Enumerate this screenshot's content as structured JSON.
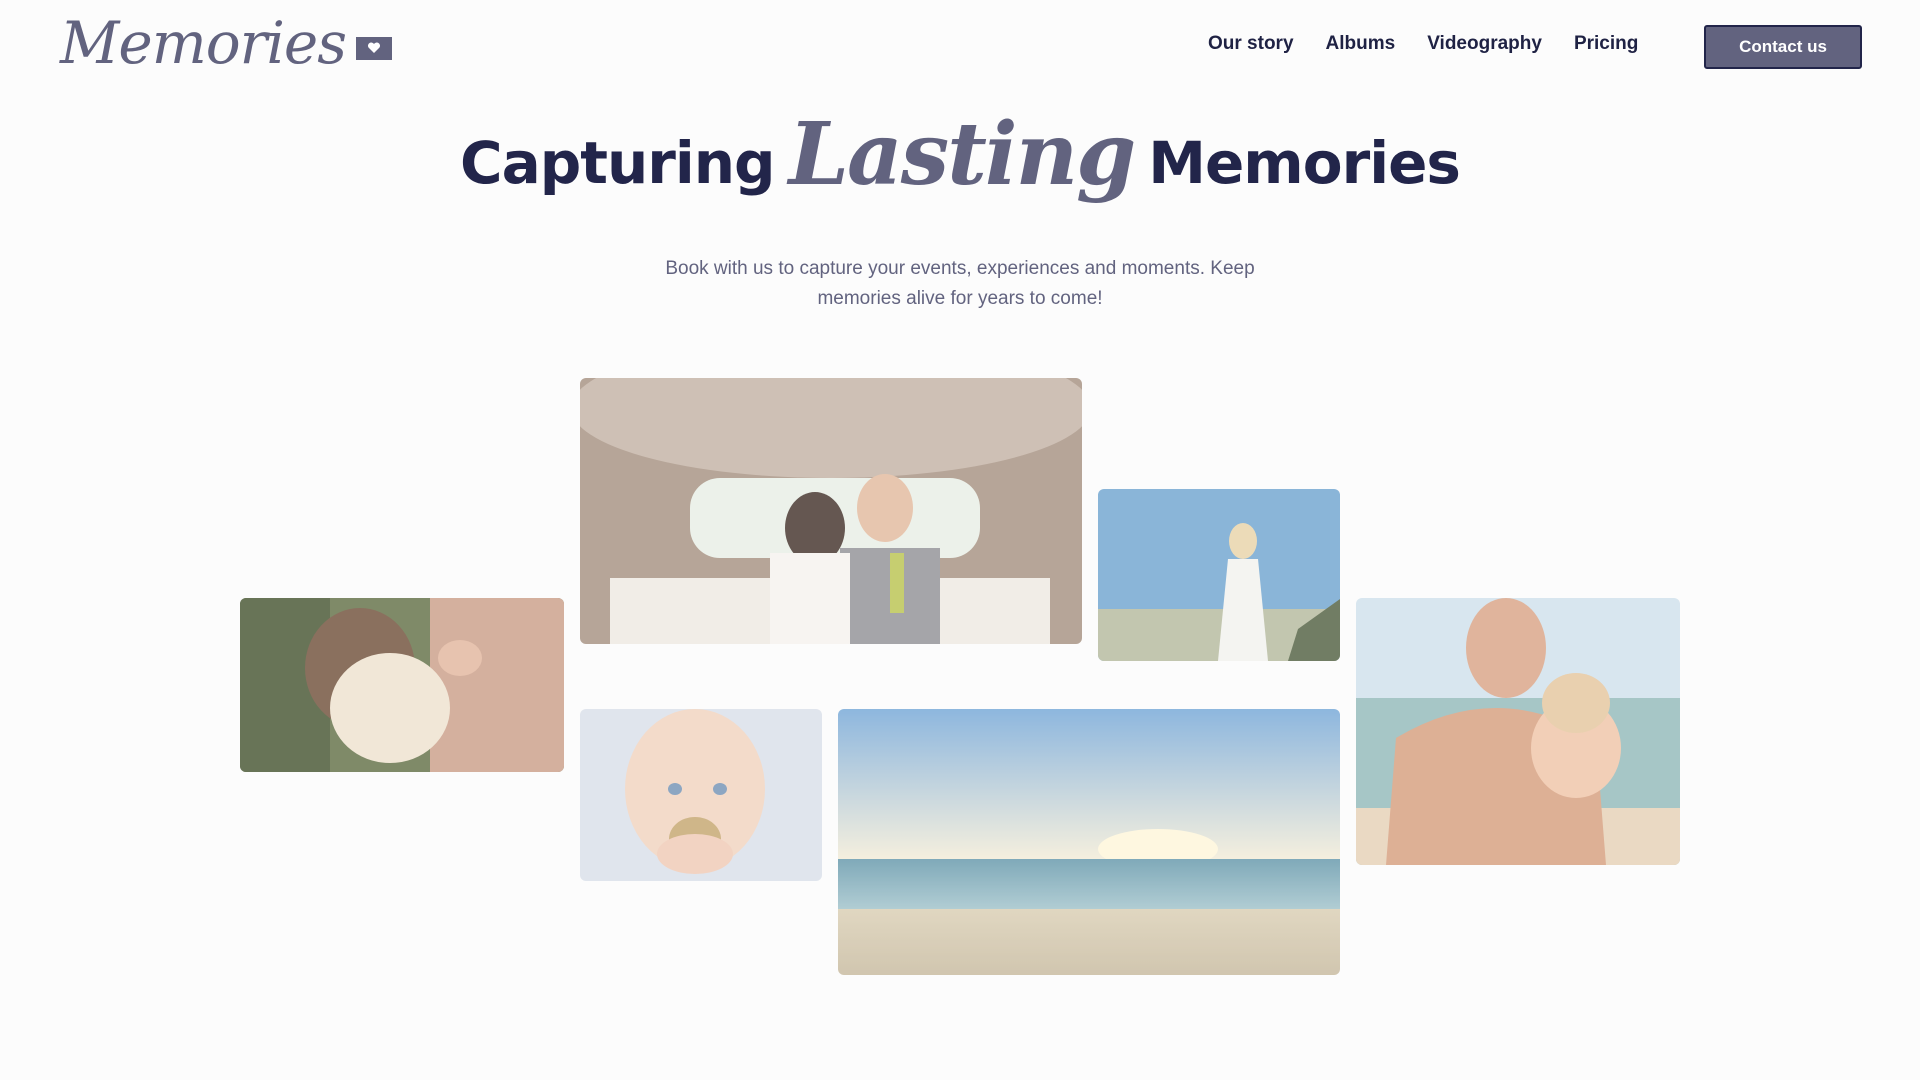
{
  "header": {
    "logo_text": "Memories",
    "logo_icon": "heart-icon",
    "nav": [
      {
        "label": "Our story"
      },
      {
        "label": "Albums"
      },
      {
        "label": "Videography"
      },
      {
        "label": "Pricing"
      }
    ],
    "cta_label": "Contact us"
  },
  "hero": {
    "title_prefix": "Capturing",
    "title_script": "Lasting",
    "title_suffix": "Memories",
    "subtitle": "Book with us to capture your events, experiences and moments. Keep memories alive for years to come!"
  },
  "colors": {
    "background": "#fcfcfc",
    "primary_dark": "#22254a",
    "accent": "#62637f"
  }
}
